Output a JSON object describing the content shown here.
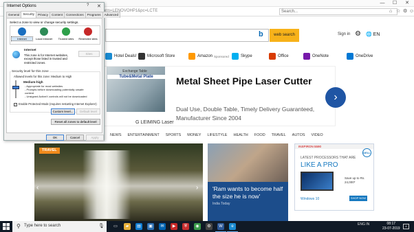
{
  "browser": {
    "url_fragment": "form=LENOVOHP1&pc=LCTE",
    "search_placeholder": "Search...",
    "minimize_glyph": "—",
    "maximize_glyph": "☐",
    "close_glyph": "✕",
    "home_glyph": "⌂",
    "star_glyph": "☆",
    "tools_glyph": "⚙",
    "smiley_glyph": "☺"
  },
  "msn": {
    "search_button": "web search",
    "signin": "Sign in",
    "language": "EN",
    "quick_links": [
      {
        "label": "Hotel Deals!",
        "icon": "hotel-icon",
        "color": "#1a8bd1"
      },
      {
        "label": "Microsoft Store",
        "icon": "microsoft-store-icon",
        "color": "#333333"
      },
      {
        "label": "Amazon",
        "sub": "Sponsored",
        "icon": "amazon-icon",
        "color": "#ff9900"
      },
      {
        "label": "Skype",
        "icon": "skype-icon",
        "color": "#00aff0"
      },
      {
        "label": "Office",
        "icon": "office-icon",
        "color": "#d83b01"
      },
      {
        "label": "OneNote",
        "icon": "onenote-icon",
        "color": "#7719aa"
      },
      {
        "label": "OneDrive",
        "icon": "onedrive-icon",
        "color": "#0078d4"
      }
    ],
    "nav": [
      "NEWS",
      "ENTERTAINMENT",
      "SPORTS",
      "MONEY",
      "LIFESTYLE",
      "HEALTH",
      "FOOD",
      "TRAVEL",
      "AUTOS",
      "VIDEO"
    ]
  },
  "ad_banner": {
    "image_caption": "Exchange Table",
    "image_title": "Tube&Metal Plate",
    "headline": "Metal Sheet Pipe Laser Cutter",
    "body": "Dual Use, Double Table, Timely Delivery Guaranteed, Manufacturer Since 2004",
    "brand": "G LEIMING Laser",
    "arrow": "›"
  },
  "hero": {
    "badge": "TRAVEL",
    "prev_glyph": "‹",
    "next_glyph": "›"
  },
  "story2": {
    "title": "'Ram wants to become half the size he is now'",
    "source": "India Today"
  },
  "ad2": {
    "top": "INSPIRON 5590",
    "brand": "DELL",
    "line1": "LATEST PROCESSORS THAT ARE",
    "line2": "LIKE A PRO",
    "price": "Save up to Rs. 24,000*",
    "windows": "Windows 10",
    "cta": "SHOP NOW"
  },
  "dialog": {
    "title": "Internet Options",
    "help_glyph": "?",
    "close_glyph": "✕",
    "tabs": [
      "General",
      "Security",
      "Privacy",
      "Content",
      "Connections",
      "Programs",
      "Advanced"
    ],
    "active_tab": "Security",
    "zone_prompt": "Select a zone to view or change security settings.",
    "zones": [
      {
        "label": "Internet",
        "icon": "globe-icon",
        "color": "#1b6fc0"
      },
      {
        "label": "Local intranet",
        "icon": "intranet-icon",
        "color": "#2e8b57"
      },
      {
        "label": "Trusted sites",
        "icon": "check-circle-icon",
        "color": "#2ea04a"
      },
      {
        "label": "Restricted sites",
        "icon": "no-entry-icon",
        "color": "#c62828"
      }
    ],
    "zone_name": "Internet",
    "zone_description": "This zone is for Internet websites, except those listed in trusted and restricted zones.",
    "sites_button": "Sites",
    "level_title": "Security level for this zone",
    "allowed_levels": "Allowed levels for this zone: Medium to High",
    "level_name": "Medium-high",
    "level_lines": [
      "- Appropriate for most websites",
      "- Prompts before downloading potentially unsafe",
      "  content",
      "- Unsigned ActiveX controls will not be downloaded"
    ],
    "protected_mode": "Enable Protected Mode (requires restarting Internet Explorer)",
    "protected_checked": "✓",
    "custom_level": "Custom level...",
    "default_level": "Default level",
    "reset_all": "Reset all zones to default level",
    "ok": "OK",
    "cancel": "Cancel",
    "apply": "Apply"
  },
  "taskbar": {
    "search_placeholder": "Type here to search",
    "tray_lang": "ENG",
    "tray_region": "IN",
    "time": "08:17",
    "date": "23-07-2019",
    "notification_count": "4"
  }
}
